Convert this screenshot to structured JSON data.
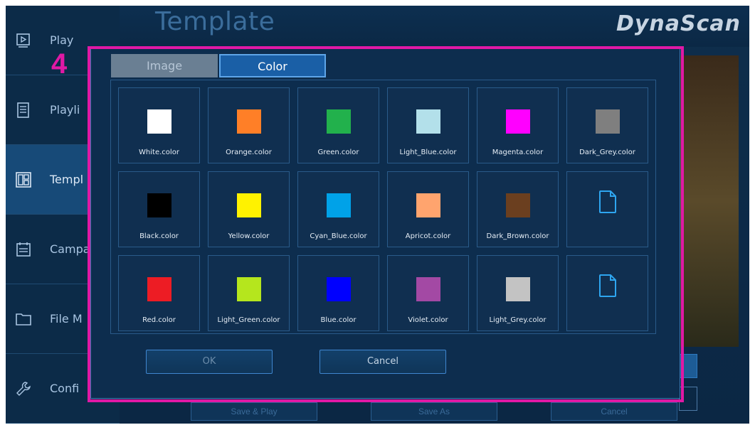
{
  "app": {
    "title": "Template",
    "brand": "DynaScan"
  },
  "sidebar": {
    "items": [
      {
        "label": "Play",
        "icon": "play-icon",
        "active": false
      },
      {
        "label": "Playli",
        "icon": "playlist-icon",
        "active": false
      },
      {
        "label": "Templ",
        "icon": "template-icon",
        "active": true
      },
      {
        "label": "Campa",
        "icon": "campaign-icon",
        "active": false
      },
      {
        "label": "File M",
        "icon": "folder-icon",
        "active": false
      },
      {
        "label": "Confi",
        "icon": "wrench-icon",
        "active": false
      }
    ]
  },
  "background_buttons": {
    "save_play": "Save & Play",
    "save_as": "Save As",
    "cancel": "Cancel"
  },
  "step_marker": "4",
  "dialog": {
    "tabs": [
      {
        "label": "Image",
        "selected": false
      },
      {
        "label": "Color",
        "selected": true
      }
    ],
    "items": [
      {
        "label": "White.color",
        "color": "#ffffff"
      },
      {
        "label": "Orange.color",
        "color": "#ff7f27"
      },
      {
        "label": "Green.color",
        "color": "#22b14c"
      },
      {
        "label": "Light_Blue.color",
        "color": "#b3e0ea"
      },
      {
        "label": "Magenta.color",
        "color": "#ff00ff"
      },
      {
        "label": "Dark_Grey.color",
        "color": "#7f7f7f"
      },
      {
        "label": "Black.color",
        "color": "#000000"
      },
      {
        "label": "Yellow.color",
        "color": "#fff200"
      },
      {
        "label": "Cyan_Blue.color",
        "color": "#00a2e8"
      },
      {
        "label": "Apricot.color",
        "color": "#ffa46e"
      },
      {
        "label": "Dark_Brown.color",
        "color": "#6b3f1f"
      },
      {
        "label": "",
        "color": null
      },
      {
        "label": "Red.color",
        "color": "#ed1c24"
      },
      {
        "label": "Light_Green.color",
        "color": "#b5e61d"
      },
      {
        "label": "Blue.color",
        "color": "#0000ff"
      },
      {
        "label": "Violet.color",
        "color": "#a349a4"
      },
      {
        "label": "Light_Grey.color",
        "color": "#c3c3c3"
      },
      {
        "label": "",
        "color": null
      }
    ],
    "ok_label": "OK",
    "cancel_label": "Cancel"
  }
}
